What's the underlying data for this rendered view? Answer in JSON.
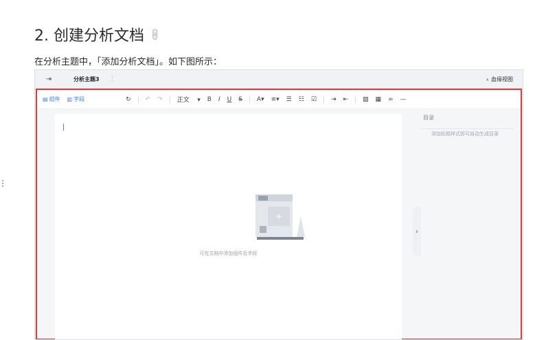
{
  "doc": {
    "heading": "2. 创建分析文档",
    "paragraph": "在分析主题中，「添加分析文档」。如下图所示："
  },
  "screenshot": {
    "topbar": {
      "tab_name": "分析主题3",
      "lineage_label": "血缘视图"
    },
    "toolbar": {
      "component_label": "组件",
      "field_label": "字段",
      "style_select": "正文"
    },
    "editor": {
      "empty_hint": "可在文档中添加组件及字段"
    },
    "toc": {
      "title": "目录",
      "hint": "添加标题样式即可自动生成目录"
    },
    "highlight_color": "#e53935",
    "accent_color": "#3b82f6"
  }
}
